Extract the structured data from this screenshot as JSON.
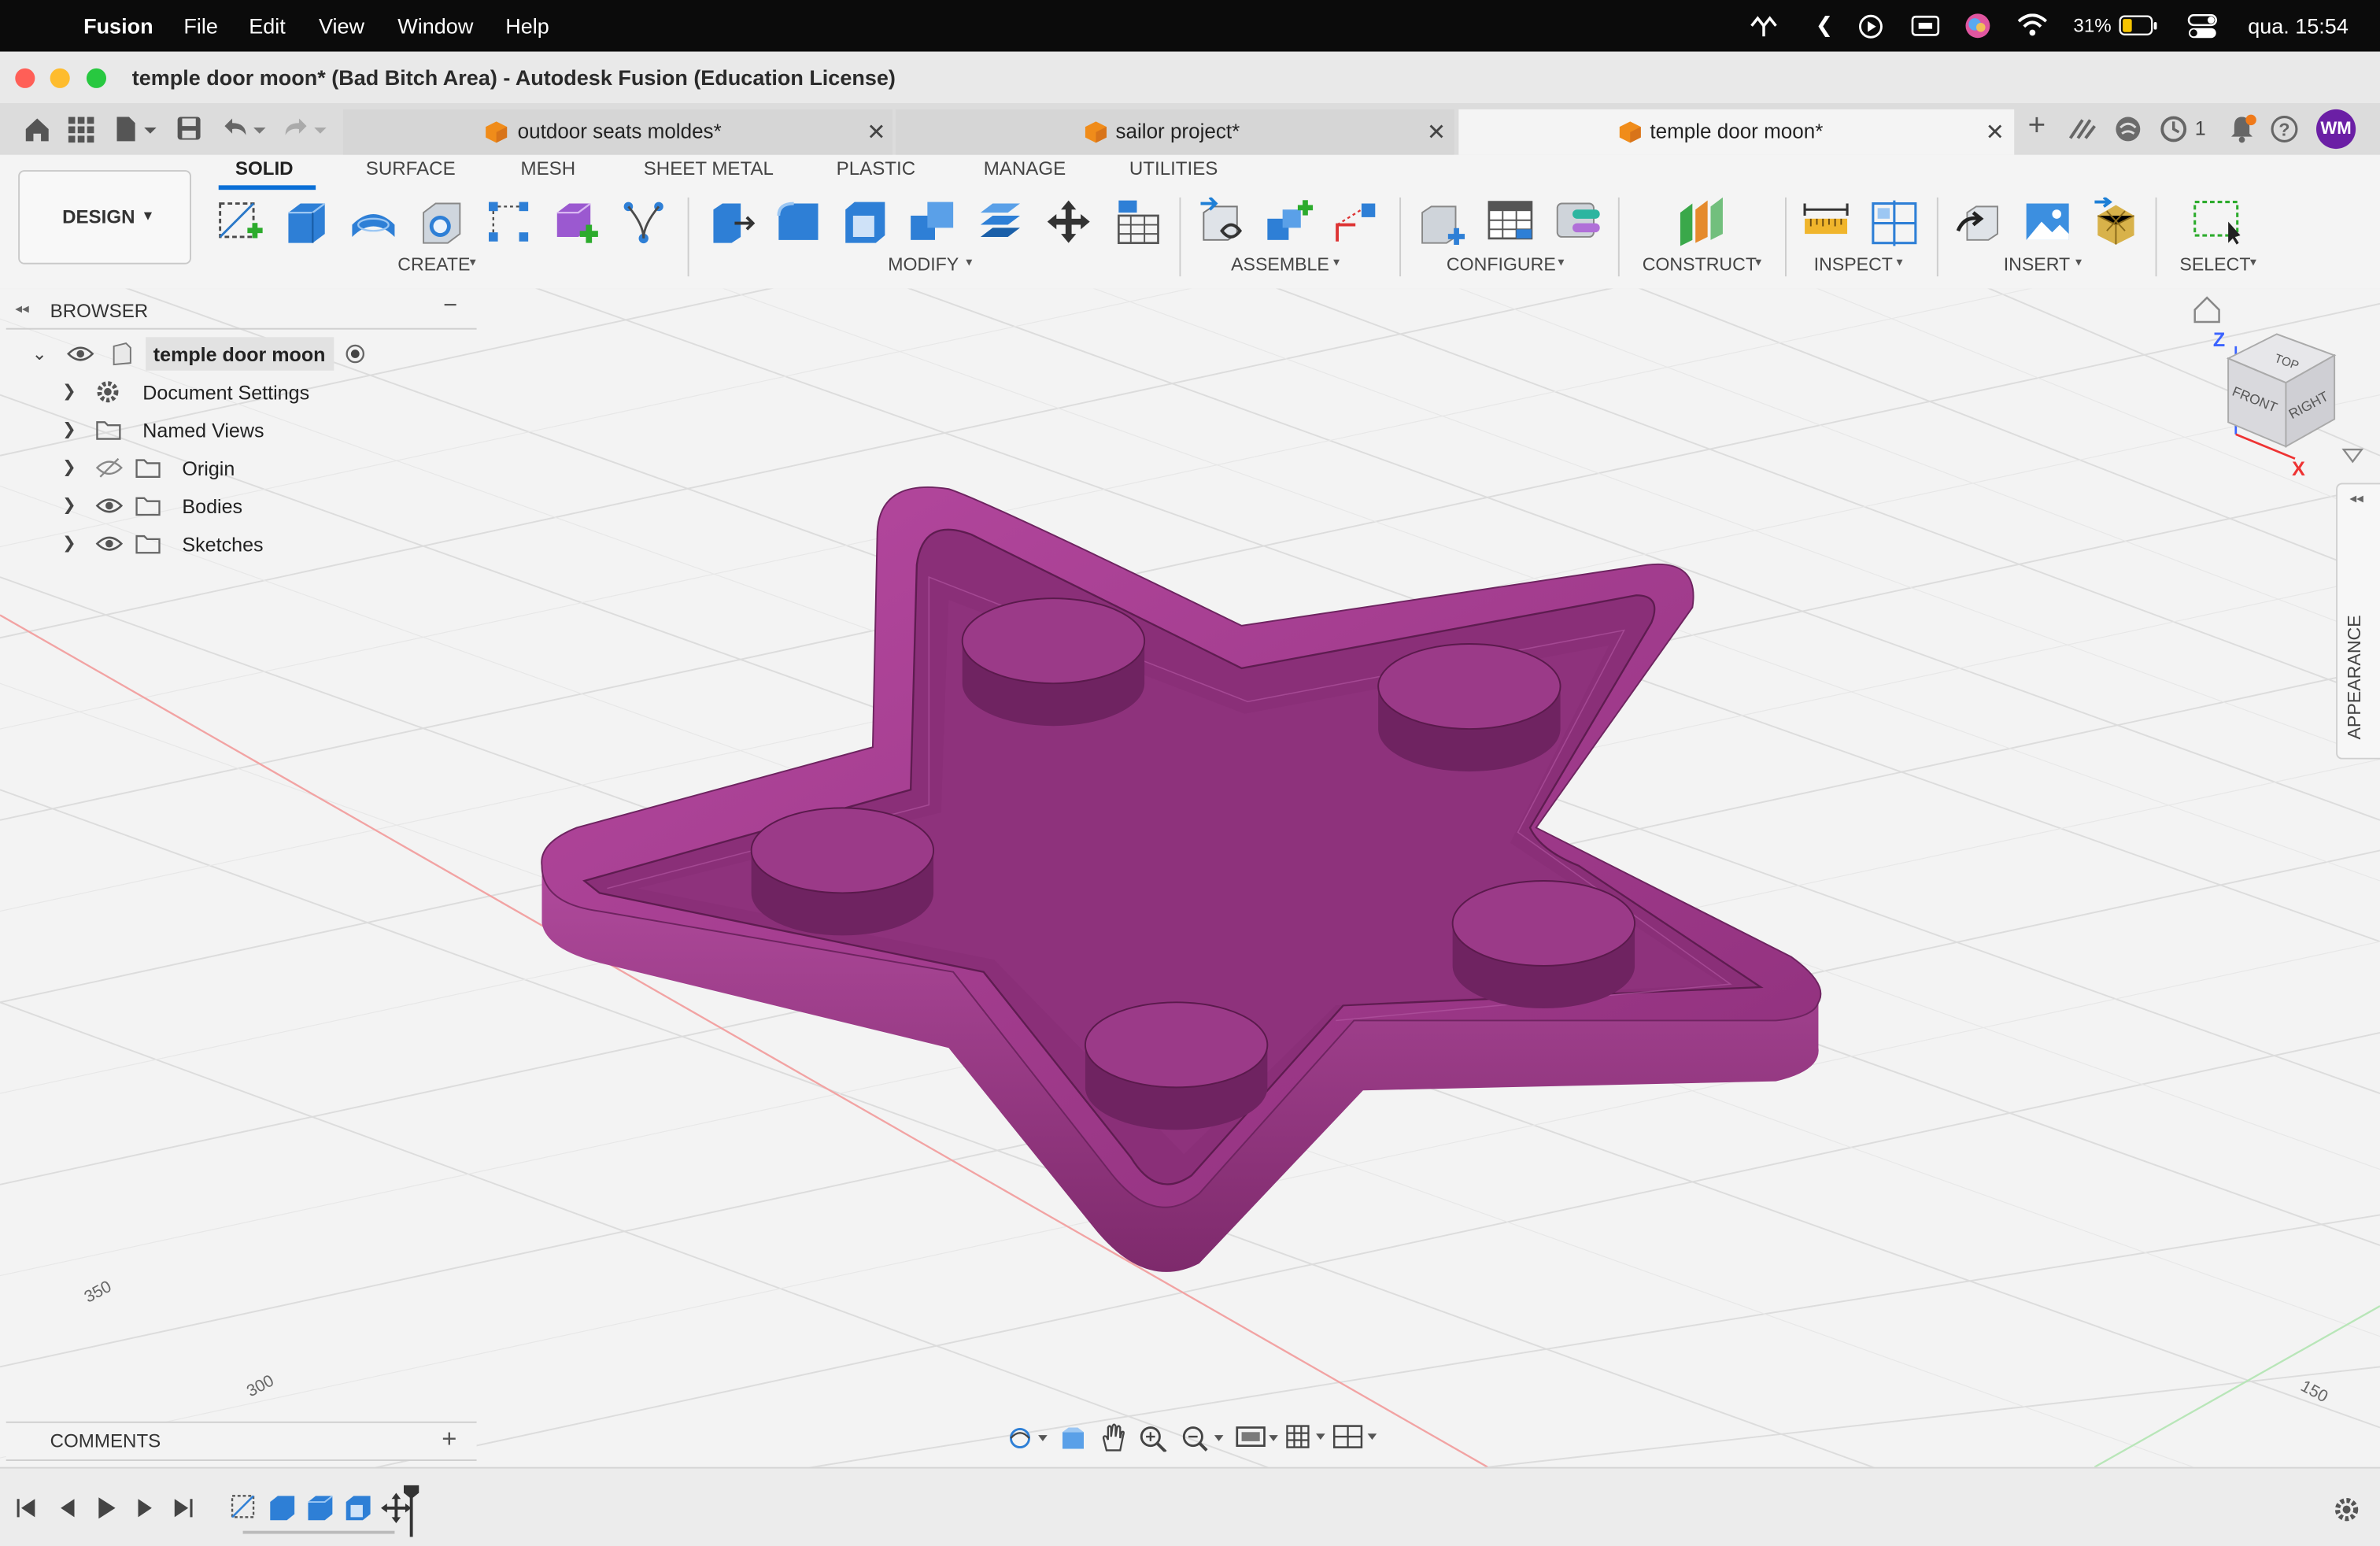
{
  "menubar": {
    "app_name": "Fusion",
    "items": [
      "File",
      "Edit",
      "View",
      "Window",
      "Help"
    ],
    "battery": "31%",
    "clock": "qua. 15:54"
  },
  "window": {
    "title": "temple door moon* (Bad Bitch Area) - Autodesk Fusion (Education License)"
  },
  "tabs": [
    {
      "label": "outdoor seats moldes*"
    },
    {
      "label": "sailor project*"
    },
    {
      "label": "temple door moon*"
    }
  ],
  "tabbar_right": {
    "jobs_count": "1",
    "user_initials": "WM"
  },
  "workspace": {
    "label": "DESIGN"
  },
  "toolbar_tabs": [
    "SOLID",
    "SURFACE",
    "MESH",
    "SHEET METAL",
    "PLASTIC",
    "MANAGE",
    "UTILITIES"
  ],
  "groups": {
    "create": "CREATE",
    "modify": "MODIFY",
    "assemble": "ASSEMBLE",
    "configure": "CONFIGURE",
    "construct": "CONSTRUCT",
    "inspect": "INSPECT",
    "insert": "INSERT",
    "select": "SELECT"
  },
  "browser": {
    "title": "BROWSER",
    "root": "temple door moon",
    "items": [
      "Document Settings",
      "Named Views",
      "Origin",
      "Bodies",
      "Sketches"
    ]
  },
  "comments": {
    "title": "COMMENTS"
  },
  "appearance": {
    "label": "APPEARANCE"
  },
  "viewcube": {
    "top": "TOP",
    "front": "FRONT",
    "right": "RIGHT",
    "z": "Z",
    "x": "X"
  },
  "grid_labels": [
    "350",
    "300",
    "150"
  ],
  "colors": {
    "model": "#a33a8d",
    "accent": "#0a6fd6",
    "avatar": "#6b1fa5"
  }
}
